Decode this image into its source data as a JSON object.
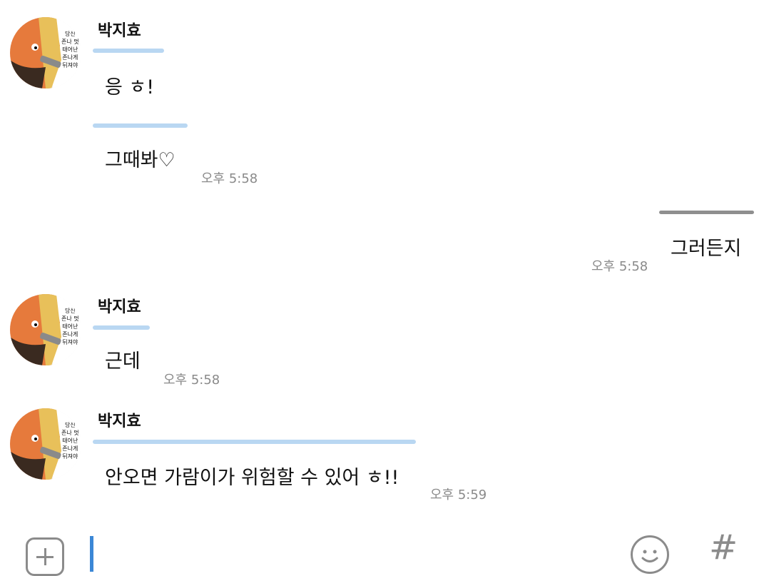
{
  "messages": [
    {
      "sender": "박지효",
      "lines": [
        "응 ㅎ!",
        "그때봐♡"
      ],
      "time": "오후 5:58",
      "avatar_text": [
        "당신",
        "존나 멋",
        "태어난",
        "존나게",
        "뒤져야"
      ]
    },
    {
      "mine": true,
      "lines": [
        "그러든지"
      ],
      "time": "오후 5:58"
    },
    {
      "sender": "박지효",
      "lines": [
        "근데"
      ],
      "time": "오후 5:58",
      "avatar_text": [
        "당신",
        "존나 멋",
        "태어난",
        "존나게",
        "뒤져야"
      ]
    },
    {
      "sender": "박지효",
      "lines": [
        "안오면 가람이가 위험할 수 있어 ㅎ!!"
      ],
      "time": "오후 5:59",
      "avatar_text": [
        "당신",
        "존나 멋",
        "태어난",
        "존나게",
        "뒤져야"
      ]
    }
  ],
  "composer": {
    "add_icon": "plus-square-icon",
    "emoji_icon": "smiley-icon",
    "hash_label": "#"
  },
  "colors": {
    "bubble_other": "#b9d7f2",
    "bubble_mine": "#8f8f8f",
    "caret": "#3b87d6",
    "time": "#8a8a8a"
  }
}
